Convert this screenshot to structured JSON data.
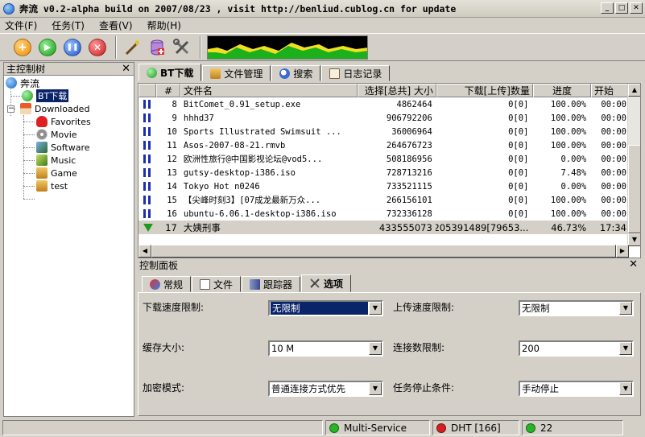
{
  "window": {
    "title": "奔流 v0.2-alpha build on 2007/08/23 , visit http://benliud.cublog.cn for update",
    "minimize": "_",
    "maximize": "□",
    "close": "✕"
  },
  "menu": {
    "items": [
      "文件(F)",
      "任务(T)",
      "查看(V)",
      "帮助(H)"
    ]
  },
  "toolbar": {
    "add": "+",
    "start": "▶",
    "pause": "❚❚",
    "stop": "✕"
  },
  "left_panel": {
    "title": "主控制树",
    "close": "✕",
    "tree": {
      "root": "奔流",
      "bt": "BT下载",
      "downloaded": "Downloaded",
      "children": [
        "Favorites",
        "Movie",
        "Software",
        "Music",
        "Game",
        "test"
      ]
    }
  },
  "top_tabs": [
    "BT下载",
    "文件管理",
    "搜索",
    "日志记录"
  ],
  "table": {
    "columns": [
      "#",
      "文件名",
      "选择[总共] 大小",
      "下载[上传]数量",
      "进度",
      "开始"
    ],
    "rows": [
      {
        "n": "8",
        "name": "BitComet_0.91_setup.exe",
        "size": "4862464",
        "dl": "0[0]",
        "progress": "100.00%",
        "start": "00:00",
        "status": "paused"
      },
      {
        "n": "9",
        "name": "hhhd37",
        "size": "906792206",
        "dl": "0[0]",
        "progress": "100.00%",
        "start": "00:00",
        "status": "paused"
      },
      {
        "n": "10",
        "name": "Sports Illustrated Swimsuit ...",
        "size": "36006964",
        "dl": "0[0]",
        "progress": "100.00%",
        "start": "00:00",
        "status": "paused"
      },
      {
        "n": "11",
        "name": "Asos-2007-08-21.rmvb",
        "size": "264676723",
        "dl": "0[0]",
        "progress": "100.00%",
        "start": "00:00",
        "status": "paused"
      },
      {
        "n": "12",
        "name": "欧洲性旅行@中国影视论坛@vod5...",
        "size": "508186956",
        "dl": "0[0]",
        "progress": "0.00%",
        "start": "00:00",
        "status": "paused"
      },
      {
        "n": "13",
        "name": "gutsy-desktop-i386.iso",
        "size": "728713216",
        "dl": "0[0]",
        "progress": "7.48%",
        "start": "00:00",
        "status": "paused"
      },
      {
        "n": "14",
        "name": "Tokyo Hot n0246",
        "size": "733521115",
        "dl": "0[0]",
        "progress": "0.00%",
        "start": "00:00",
        "status": "paused"
      },
      {
        "n": "15",
        "name": "【尖峰时刻3】[07成龙最新万众...",
        "size": "266156101",
        "dl": "0[0]",
        "progress": "100.00%",
        "start": "00:00",
        "status": "paused"
      },
      {
        "n": "16",
        "name": "ubuntu-6.06.1-desktop-i386.iso",
        "size": "732336128",
        "dl": "0[0]",
        "progress": "100.00%",
        "start": "00:00",
        "status": "paused"
      },
      {
        "n": "17",
        "name": "大姨刑事",
        "size": "433555073",
        "dl": "205391489[79653...",
        "progress": "46.73%",
        "start": "17:34",
        "status": "downloading"
      }
    ]
  },
  "control_panel": {
    "title": "控制面板",
    "close": "✕",
    "tabs": [
      "常规",
      "文件",
      "跟踪器",
      "选项"
    ],
    "options": {
      "download_limit_label": "下载速度限制:",
      "download_limit_value": "无限制",
      "upload_limit_label": "上传速度限制:",
      "upload_limit_value": "无限制",
      "cache_label": "缓存大小:",
      "cache_value": "10 M",
      "conn_label": "连接数限制:",
      "conn_value": "200",
      "encrypt_label": "加密模式:",
      "encrypt_value": "普通连接方式优先",
      "stop_label": "任务停止条件:",
      "stop_value": "手动停止"
    }
  },
  "statusbar": {
    "multi_service": "Multi-Service",
    "dht": "DHT [166]",
    "third": "22"
  },
  "colors": {
    "selection": "#0a246a",
    "green_status": "#27b427",
    "red_status": "#d42020"
  }
}
